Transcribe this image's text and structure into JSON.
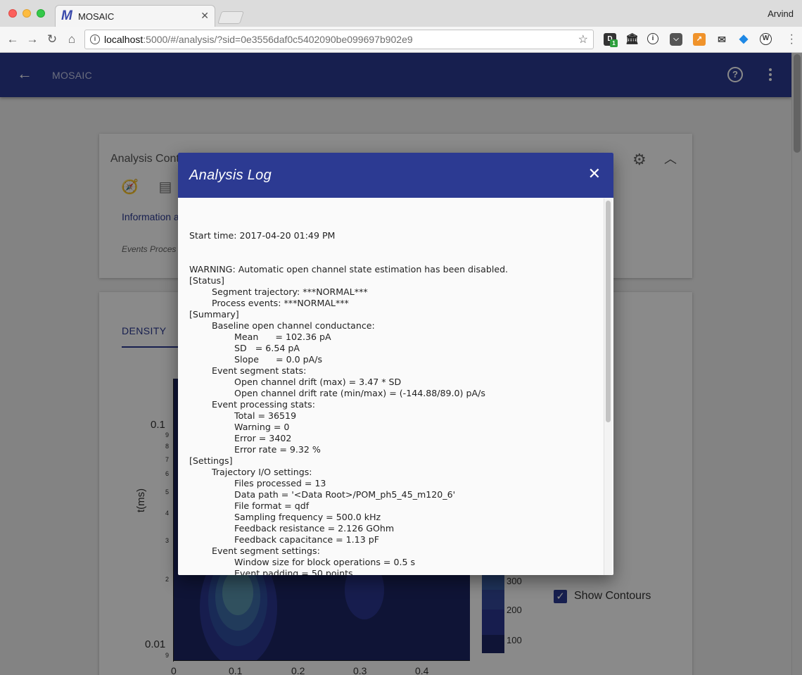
{
  "browser": {
    "tab_title": "MOSAIC",
    "tab_favicon": "M",
    "profile_name": "Arvind",
    "url_host": "localhost",
    "url_rest": ":5000/#/analysis/?sid=0e3556daf0c5402090be099697b902e9",
    "extension_badge": "1"
  },
  "app": {
    "title": "MOSAIC"
  },
  "analysis_card": {
    "title": "Analysis Cont",
    "link_text": "Information a",
    "status_text": "Events Proces"
  },
  "plot_card": {
    "tab_label": "DENSITY",
    "ylabel": "t(ms)",
    "y_major_ticks": [
      "0.1",
      "0.01"
    ],
    "y_minor_ticks": [
      "9",
      "8",
      "7",
      "6",
      "5",
      "4",
      "3",
      "2",
      "9"
    ],
    "x_ticks": [
      "0",
      "0.1",
      "0.2",
      "0.3",
      "0.4"
    ],
    "colorbar_labels": [
      "300",
      "200",
      "100"
    ],
    "colors": {
      "background": "#1d2665",
      "contour_outer": "#2f3d9a",
      "contour_mid": "#3d67a8",
      "contour_inner": "#6aa8b0"
    },
    "show_contours_label": "Show Contours",
    "show_contours_checked": true
  },
  "modal": {
    "title": "Analysis Log",
    "lines": [
      "Start time: 2017-04-20 01:49 PM",
      "",
      "",
      "WARNING: Automatic open channel state estimation has been disabled.",
      "[Status]",
      "        Segment trajectory: ***NORMAL***",
      "        Process events: ***NORMAL***",
      "[Summary]",
      "        Baseline open channel conductance:",
      "                Mean      = 102.36 pA",
      "                SD   = 6.54 pA",
      "                Slope      = 0.0 pA/s",
      "        Event segment stats:",
      "                Open channel drift (max) = 3.47 * SD",
      "                Open channel drift rate (min/max) = (-144.88/89.0) pA/s",
      "        Event processing stats:",
      "                Total = 36519",
      "                Warning = 0",
      "                Error = 3402",
      "                Error rate = 9.32 %",
      "[Settings]",
      "        Trajectory I/O settings:",
      "                Files processed = 13",
      "                Data path = '<Data Root>/POM_ph5_45_m120_6'",
      "                File format = qdf",
      "                Sampling frequency = 500.0 kHz",
      "                Feedback resistance = 2.126 GOhm",
      "                Feedback capacitance = 1.13 pF",
      "        Event segment settings:",
      "                Window size for block operations = 0.5 s",
      "                Event padding = 50 points"
    ]
  }
}
